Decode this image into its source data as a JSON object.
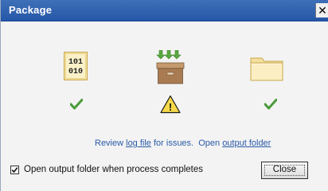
{
  "window": {
    "title": "Package",
    "close_glyph": "✕"
  },
  "steps": [
    {
      "icon": "binary-file-icon",
      "icon_text_top": "101",
      "icon_text_bottom": "010",
      "status": "success-check-icon"
    },
    {
      "icon": "package-box-icon",
      "status": "warning-icon",
      "warning_glyph": "!"
    },
    {
      "icon": "folder-icon",
      "status": "success-check-icon"
    }
  ],
  "links_line": {
    "review_prefix": "Review ",
    "log_file_link": "log file",
    "review_suffix": " for issues.  Open ",
    "output_folder_link": "output folder"
  },
  "options": {
    "open_output_label": "Open output folder when process completes",
    "open_output_checked": true
  },
  "buttons": {
    "close_label": "Close"
  },
  "colors": {
    "titlebar": "#2557a8",
    "link": "#2a5ba8",
    "check_green": "#4a9a3a",
    "warning_yellow": "#f4d03f"
  }
}
